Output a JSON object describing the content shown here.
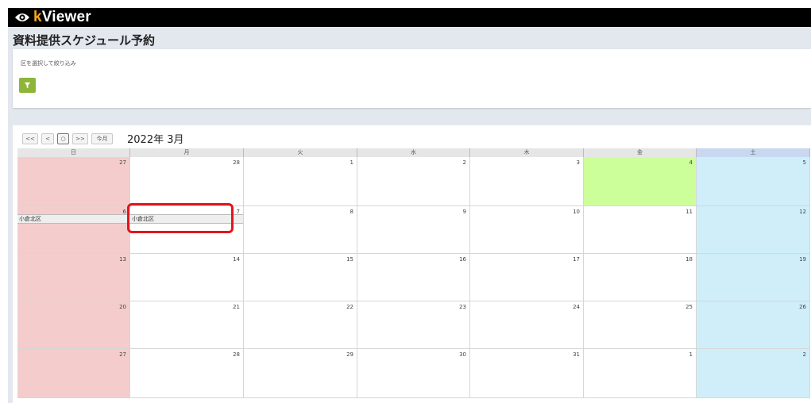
{
  "app": {
    "logo_text_rest": "Viewer",
    "logo_text_k": "k"
  },
  "page": {
    "title": "資料提供スケジュール予約"
  },
  "filter": {
    "hint": "区を選択して絞り込み",
    "button_icon": "filter-icon"
  },
  "calendar": {
    "nav": {
      "prev_year": "<<",
      "prev_month": "<",
      "current": "○",
      "next_month": ">>",
      "today": "今月"
    },
    "month_label": "2022年 3月",
    "weekdays": [
      "日",
      "月",
      "火",
      "水",
      "木",
      "金",
      "土"
    ],
    "weeks": [
      [
        "27",
        "28",
        "1",
        "2",
        "3",
        "4",
        "5"
      ],
      [
        "6",
        "7",
        "8",
        "9",
        "10",
        "11",
        "12"
      ],
      [
        "13",
        "14",
        "15",
        "16",
        "17",
        "18",
        "19"
      ],
      [
        "20",
        "21",
        "22",
        "23",
        "24",
        "25",
        "26"
      ],
      [
        "27",
        "28",
        "29",
        "30",
        "31",
        "1",
        "2"
      ]
    ],
    "events": [
      {
        "label": "小倉北区"
      }
    ],
    "colors": {
      "sunday": "#f4cccc",
      "saturday": "#cfeefa",
      "today": "#ccff99",
      "header": "#e6e6e6",
      "saturday_header": "#c9d8f0"
    }
  },
  "annotation": {
    "color": "#e3151c"
  }
}
